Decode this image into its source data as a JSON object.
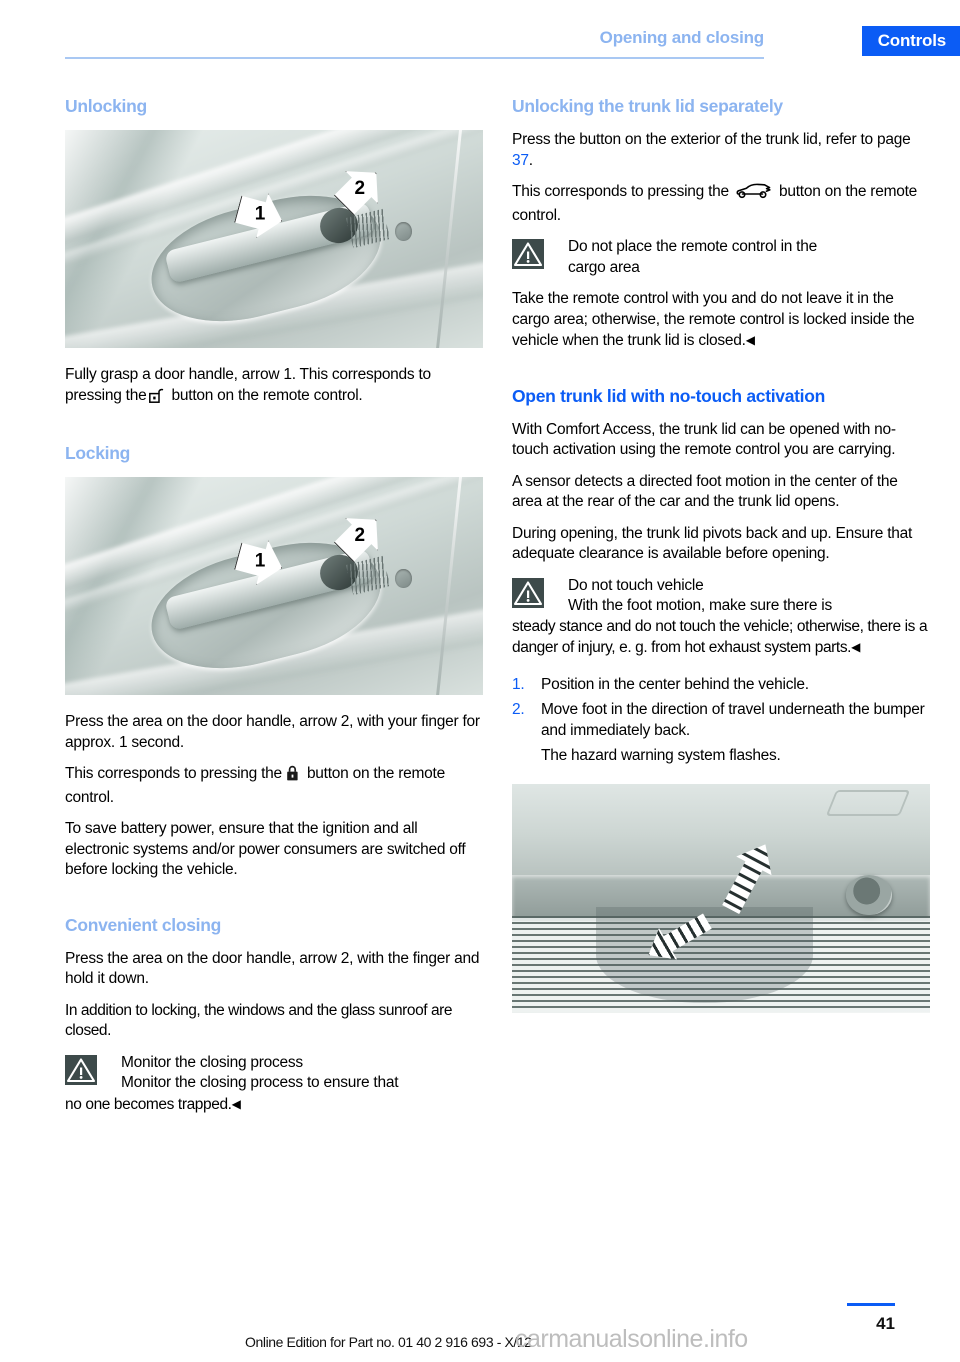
{
  "header": {
    "chapter": "Opening and closing",
    "section": "Controls"
  },
  "left_column": {
    "unlocking": {
      "title": "Unlocking",
      "figure_caption": "door-handle-unlock-illustration",
      "arrow_labels": [
        "1",
        "2"
      ],
      "paragraphs": [
        "Fully grasp a door handle, arrow 1. This corresponds to pressing the",
        "button on the remote control."
      ]
    },
    "locking": {
      "title": "Locking",
      "figure_caption": "door-handle-lock-illustration",
      "arrow_labels": [
        "1",
        "2"
      ],
      "p1": "Press the area on the door handle, arrow 2, with your finger for approx. 1 second.",
      "p2_before": "This corresponds to pressing the",
      "p2_after": "button on the remote control.",
      "p3": "To save battery power, ensure that the ignition and all electronic systems and/or power consumers are switched off before locking the vehicle."
    },
    "convenient_closing": {
      "title": "Convenient closing",
      "p1": "Press the area on the door handle, arrow 2, with the finger and hold it down.",
      "p2": "In addition to locking, the windows and the glass sunroof are closed.",
      "warning_title": "Monitor the closing process",
      "warning_first": "Monitor the closing process to ensure that",
      "warning_rest": "no one becomes trapped.",
      "endmark": "◀"
    }
  },
  "right_column": {
    "unlock_trunk": {
      "title": "Unlocking the trunk lid separately",
      "p1_before": "Press the button on the exterior of the trunk lid, refer to page",
      "p1_page_ref": "37",
      "p1_after": ".",
      "p2_before": "This corresponds to pressing the",
      "p2_after": "button on the remote control.",
      "warning_title_line1": "Do not place the remote control in the",
      "warning_title_line2": "cargo area",
      "warning_body": "Take the remote control with you and do not leave it in the cargo area; otherwise, the remote control is locked inside the vehicle when the trunk lid is closed.",
      "endmark": "◀"
    },
    "no_touch": {
      "title": "Open trunk lid with no-touch activation",
      "p1": "With Comfort Access, the trunk lid can be opened with no-touch activation using the remote control you are carrying.",
      "p2": "A sensor detects a directed foot motion in the center of the area at the rear of the car and the trunk lid opens.",
      "p3": "During opening, the trunk lid pivots back and up. Ensure that adequate clearance is available before opening.",
      "warning_title": "Do not touch vehicle",
      "warning_first": "With the foot motion, make sure there is",
      "warning_rest": "steady stance and do not touch the vehicle; otherwise, there is a danger of injury, e. g. from hot exhaust system parts.",
      "endmark": "◀",
      "steps": [
        {
          "num": "1.",
          "text": "Position in the center behind the vehicle."
        },
        {
          "num": "2.",
          "text": "Move foot in the direction of travel underneath the bumper and immediately back."
        }
      ],
      "step_note": "The hazard warning system flashes.",
      "figure_caption": "rear-bumper-foot-motion-illustration"
    }
  },
  "footer": {
    "edition": "Online Edition for Part no. 01 40 2 916 693 - X/12",
    "watermark": "carmanualsonline.info",
    "page_number": "41"
  },
  "colors": {
    "banner_blue": "#0B5CF5",
    "heading_light_blue": "#8CB4F0",
    "heading_strong_blue": "#0B5CF5",
    "warning_icon_bg": "#3D4A4A",
    "text_black": "#000000"
  },
  "icons": {
    "unlock_padlock": "unlock-padlock-icon",
    "lock_padlock": "lock-padlock-icon",
    "trunk_car": "car-trunk-icon",
    "warning": "warning-triangle-icon"
  }
}
